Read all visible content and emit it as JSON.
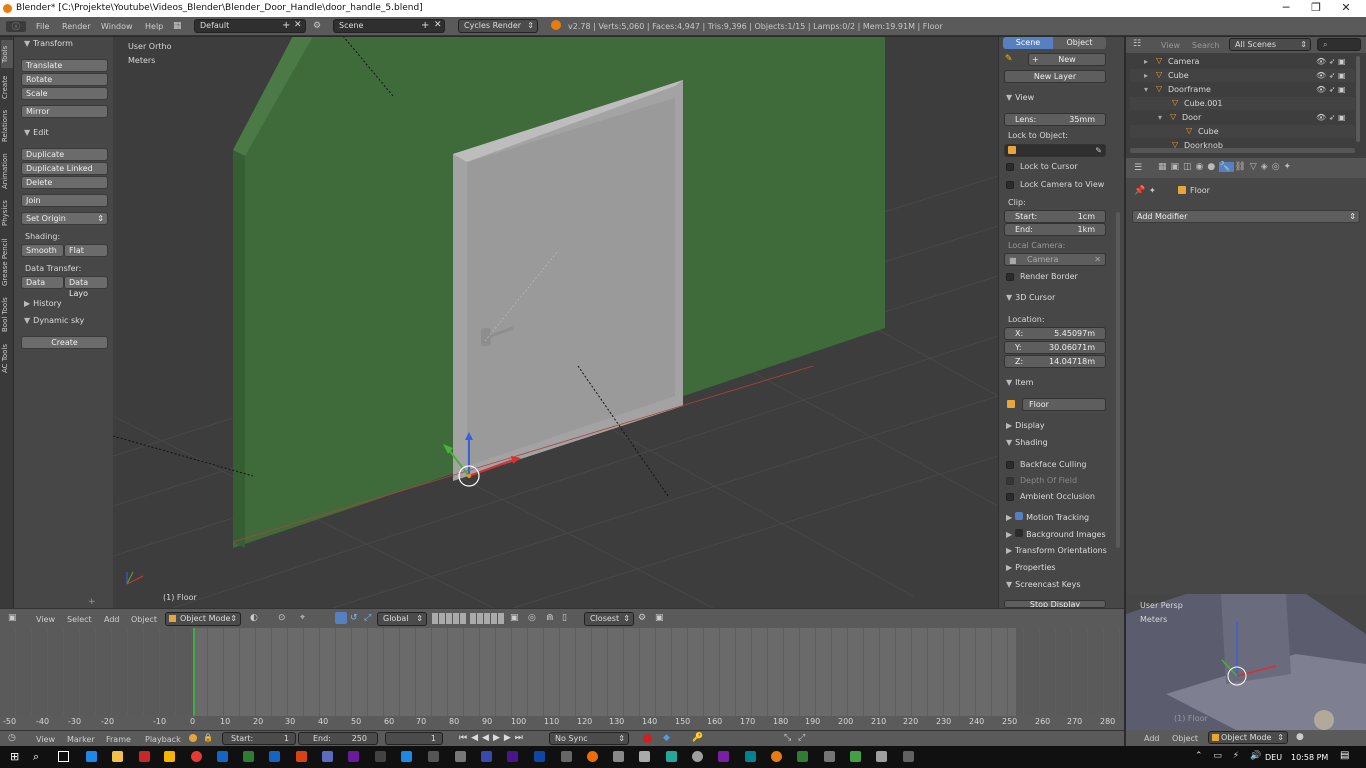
{
  "window": {
    "title": "Blender* [C:\\Projekte\\Youtube\\Videos_Blender\\Blender_Door_Handle\\door_handle_5.blend]",
    "min": "─",
    "max": "❐",
    "close": "✕"
  },
  "topbar": {
    "menus": [
      "File",
      "Render",
      "Window",
      "Help"
    ],
    "layout": "Default",
    "scene": "Scene",
    "engine": "Cycles Render",
    "stats": "v2.78 | Verts:5,060 | Faces:4,947 | Tris:9,396 | Objects:1/15 | Lamps:0/2 | Mem:19.91M | Floor"
  },
  "toolshelf": {
    "tabs": [
      "Tools",
      "Create",
      "Relations",
      "Animation",
      "Physics",
      "Grease Pencil",
      "Bool Tools",
      "AC Tools"
    ],
    "transform_header": "Transform",
    "translate": "Translate",
    "rotate": "Rotate",
    "scale": "Scale",
    "mirror": "Mirror",
    "edit_header": "Edit",
    "duplicate": "Duplicate",
    "duplicate_linked": "Duplicate Linked",
    "delete": "Delete",
    "join": "Join",
    "set_origin": "Set Origin",
    "shading_label": "Shading:",
    "smooth": "Smooth",
    "flat": "Flat",
    "data_transfer_label": "Data Transfer:",
    "data": "Data",
    "data_layo": "Data Layo",
    "history_header": "History",
    "dynamic_sky_header": "Dynamic sky",
    "create": "Create"
  },
  "viewport": {
    "view_name": "User Ortho",
    "units": "Meters",
    "object_label": "(1) Floor",
    "wall_color": "#3f6b3b",
    "door_color": "#a3a3a3"
  },
  "npanel": {
    "tab_scene": "Scene",
    "tab_object": "Object",
    "new": "New",
    "new_layer": "New Layer",
    "view_header": "View",
    "lens_label": "Lens:",
    "lens_value": "35mm",
    "lock_to_object": "Lock to Object:",
    "lock_to_cursor": "Lock to Cursor",
    "lock_camera": "Lock Camera to View",
    "clip_label": "Clip:",
    "clip_start_label": "Start:",
    "clip_start": "1cm",
    "clip_end_label": "End:",
    "clip_end": "1km",
    "local_camera": "Local Camera:",
    "camera": "Camera",
    "render_border": "Render Border",
    "cursor_header": "3D Cursor",
    "location": "Location:",
    "x_label": "X:",
    "x": "5.45097m",
    "y_label": "Y:",
    "y": "30.06071m",
    "z_label": "Z:",
    "z": "14.04718m",
    "item_header": "Item",
    "item_name": "Floor",
    "display_header": "Display",
    "shading_header": "Shading",
    "backface": "Backface Culling",
    "dof": "Depth Of Field",
    "ao": "Ambient Occlusion",
    "motion_tracking": "Motion Tracking",
    "background_images": "Background Images",
    "transform_orientations": "Transform Orientations",
    "properties": "Properties",
    "screencast_keys": "Screencast Keys",
    "stop_display": "Stop Display"
  },
  "outliner": {
    "view": "View",
    "search": "Search",
    "scenes": "All Scenes",
    "items": [
      "Camera",
      "Cube",
      "Doorframe",
      "Cube.001",
      "Door",
      "Cube",
      "Doorknob"
    ]
  },
  "properties": {
    "object": "Floor",
    "add_modifier": "Add Modifier"
  },
  "miniview": {
    "view_name": "User Persp",
    "units": "Meters",
    "object_label": "(1) Floor"
  },
  "vpheader": {
    "view": "View",
    "select": "Select",
    "add": "Add",
    "object": "Object",
    "mode": "Object Mode",
    "orientation": "Global",
    "snap": "Closest"
  },
  "timeline": {
    "ticks": [
      "-50",
      "-40",
      "-30",
      "-20",
      "-10",
      "0",
      "10",
      "20",
      "30",
      "40",
      "50",
      "60",
      "70",
      "80",
      "90",
      "100",
      "110",
      "120",
      "130",
      "140",
      "150",
      "160",
      "170",
      "180",
      "190",
      "200",
      "210",
      "220",
      "230",
      "240",
      "250",
      "260",
      "270",
      "280"
    ],
    "view": "View",
    "marker": "Marker",
    "frame": "Frame",
    "playback": "Playback",
    "start_label": "Start:",
    "start": "1",
    "end_label": "End:",
    "end": "250",
    "current": "1",
    "sync": "No Sync"
  },
  "miniheader": {
    "add": "Add",
    "object": "Object",
    "mode": "Object Mode"
  },
  "taskbar": {
    "lang": "DEU",
    "time": "10:58 PM"
  }
}
